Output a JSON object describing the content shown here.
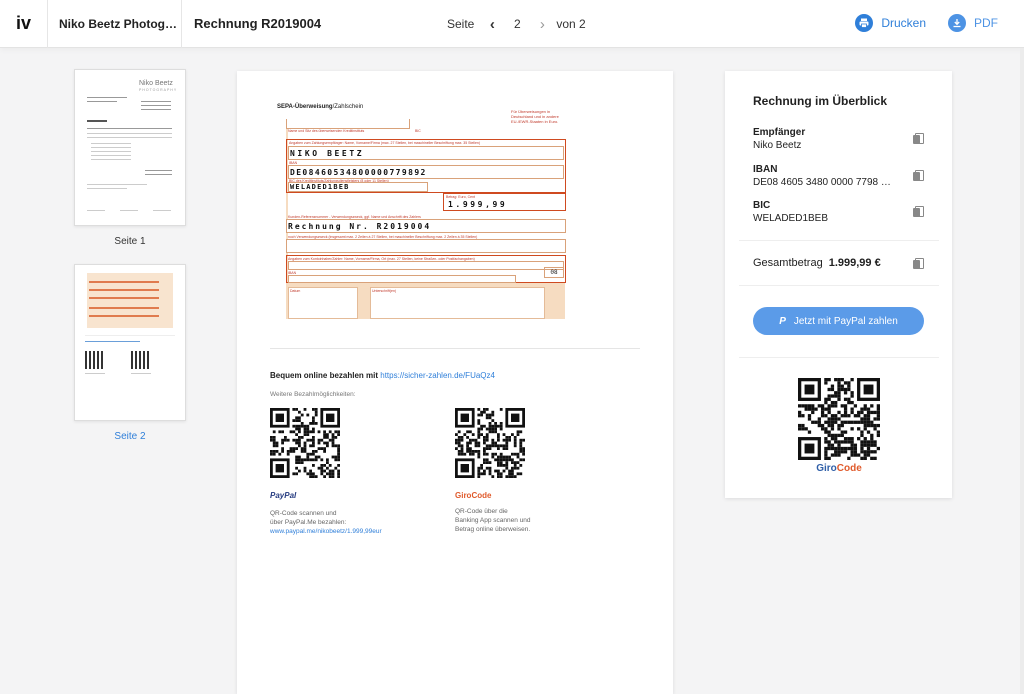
{
  "header": {
    "logo": "iv",
    "company": "Niko Beetz Photog…",
    "doc_title": "Rechnung R2019004",
    "page_label": "Seite",
    "page_current": "2",
    "page_of": "von 2",
    "print_label": "Drucken",
    "pdf_label": "PDF"
  },
  "thumbnails": [
    {
      "label": "Seite 1",
      "brand": "Niko Beetz",
      "brand_sub": "PHOTOGRAPHY"
    },
    {
      "label": "Seite 2"
    }
  ],
  "sepa": {
    "title_bold": "SEPA-Überweisung",
    "title_rest": "/Zahlschein",
    "note": "Für Überweisungen in Deutschland und in andere EU-/EWR-Staaten in Euro.",
    "bank_label": "Name und Sitz des überweisenden Kreditinstituts",
    "bic_label": "BIC",
    "recipient_label": "Angaben zum Zahlungsempfänger: Name, Vorname/Firma (max. 27 Stellen, bei maschineller Beschriftung max. 35 Stellen)",
    "recipient": "NIKO BEETZ",
    "iban_label": "IBAN",
    "iban": "DE08460534800000779892",
    "bic_field_label": "BIC des Kreditinstituts/Zahlungsdienstleisters (8 oder 11 Stellen)",
    "bic": "WELADED1BEB",
    "amount_label": "Betrag: Euro, Cent",
    "amount": "1.999,99",
    "reference_label": "Kunden-Referenznummer - Verwendungszweck, ggf. Name und Anschrift des Zahlers",
    "reference": "Rechnung Nr. R2019004",
    "reference2_label": "noch Verwendungszweck (insgesamt max. 2 Zeilen à 27 Stellen, bei maschineller Beschriftung max. 2 Zeilen à 35 Stellen)",
    "payer_label": "Angaben zum Kontoinhaber/Zahler: Name, Vorname/Firma, Ort (max. 27 Stellen, keine Straßen- oder Postfachangaben)",
    "iban2_label": "IBAN",
    "code": "08",
    "date_label": "Datum",
    "signature_label": "Unterschrift(en)"
  },
  "online": {
    "text": "Bequem online bezahlen mit",
    "link": "https://sicher-zahlen.de/FUaQz4",
    "further": "Weitere Bezahlmöglichkeiten:",
    "paypal_brand": "PayPal",
    "paypal_desc1": "QR-Code scannen und",
    "paypal_desc2": "über PayPal.Me bezahlen:",
    "paypal_link": "www.paypal.me/nikobeetz/1.999,99eur",
    "giro_brand": "GiroCode",
    "giro_desc1": "QR-Code über die",
    "giro_desc2": "Banking App scannen und",
    "giro_desc3": "Betrag online überweisen."
  },
  "panel": {
    "title": "Rechnung im Überblick",
    "recipient_label": "Empfänger",
    "recipient": "Niko Beetz",
    "iban_label": "IBAN",
    "iban": "DE08 4605 3480 0000 7798 …",
    "bic_label": "BIC",
    "bic": "WELADED1BEB",
    "total_label": "Gesamtbetrag",
    "total": "1.999,99 €",
    "paypal_button": "Jetzt mit PayPal zahlen",
    "giro_part1": "Giro",
    "giro_part2": "Code"
  },
  "colors": {
    "accent": "#2f7fd9",
    "sepa_red": "#cf4a20",
    "sepa_fill": "#f6dcc1"
  }
}
